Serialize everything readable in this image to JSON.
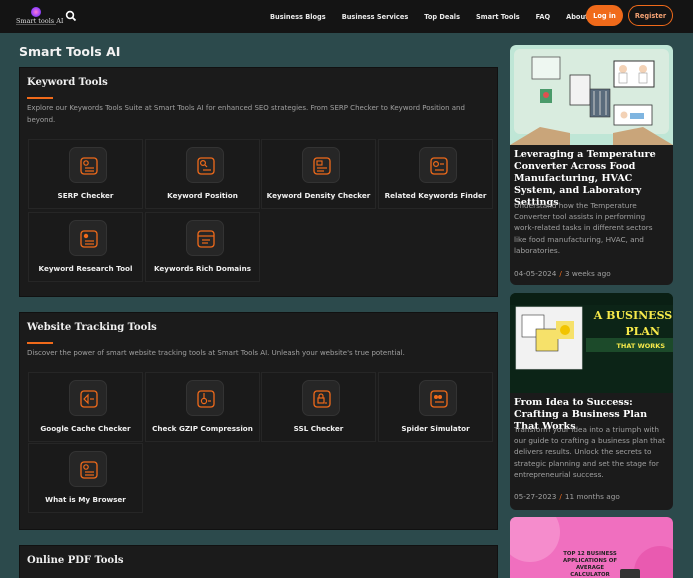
{
  "nav": {
    "logo_text": "Smart tools AI",
    "links": [
      "Business Blogs",
      "Business Services",
      "Top Deals",
      "Smart Tools",
      "FAQ",
      "About Us"
    ],
    "login": "Log in",
    "register": "Register"
  },
  "page_title": "Smart Tools AI",
  "sections": [
    {
      "title": "Keyword Tools",
      "description": "Explore our Keywords Tools Suite at Smart Tools AI for enhanced SEO strategies. From SERP Checker to Keyword Position and beyond.",
      "tools": [
        "SERP Checker",
        "Keyword Position",
        "Keyword Density Checker",
        "Related Keywords Finder",
        "Keyword Research Tool",
        "Keywords Rich Domains"
      ]
    },
    {
      "title": "Website Tracking Tools",
      "description": "Discover the power of smart website tracking tools at Smart Tools AI. Unleash your website's true potential.",
      "tools": [
        "Google Cache Checker",
        "Check GZIP Compression",
        "SSL Checker",
        "Spider Simulator",
        "What is My Browser"
      ]
    },
    {
      "title": "Online PDF Tools"
    }
  ],
  "blog": [
    {
      "title": "Leveraging a Temperature Converter Across Food Manufacturing, HVAC System, and Laboratory Settings",
      "excerpt": "Understand how the Temperature Converter tool assists in performing work-related tasks in different sectors like food manufacturing, HVAC, and laboratories.",
      "date": "04-05-2024",
      "ago": "3 weeks ago"
    },
    {
      "title": "From Idea to Success: Crafting a Business Plan That Works",
      "excerpt": "Transform your idea into a triumph with our guide to crafting a business plan that delivers results. Unlock the secrets to strategic planning and set the stage for entrepreneurial success.",
      "date": "05-27-2023",
      "ago": "11 months ago",
      "image_text": {
        "line1": "A BUSINESS",
        "line2": "PLAN",
        "line3": "THAT WORKS"
      }
    },
    {
      "image_text": {
        "line1": "TOP 12 BUSINESS",
        "line2": "APPLICATIONS OF",
        "line3": "AVERAGE",
        "line4": "CALCULATOR"
      }
    }
  ],
  "colors": {
    "accent": "#f06a1a",
    "page_bg": "#2c4a4c",
    "panel_bg": "#1b1b1b"
  }
}
